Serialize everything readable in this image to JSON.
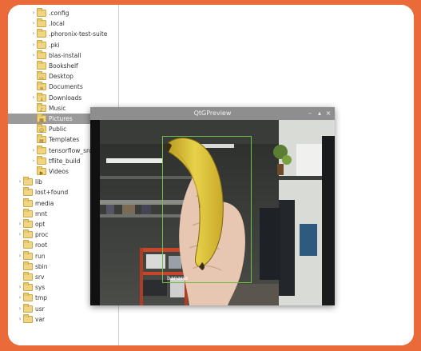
{
  "file_tree": {
    "items": [
      {
        "label": ".config",
        "expander": "›",
        "icon": "folder-icon"
      },
      {
        "label": ".local",
        "expander": "›",
        "icon": "folder-icon"
      },
      {
        "label": ".phoronix-test-suite",
        "expander": "›",
        "icon": "folder-icon"
      },
      {
        "label": ".pki",
        "expander": "›",
        "icon": "folder-icon"
      },
      {
        "label": "blas-install",
        "expander": "›",
        "icon": "folder-icon"
      },
      {
        "label": "Bookshelf",
        "expander": "",
        "icon": "folder-icon"
      },
      {
        "label": "Desktop",
        "expander": "",
        "icon": "desktop-folder-icon"
      },
      {
        "label": "Documents",
        "expander": "",
        "icon": "documents-folder-icon"
      },
      {
        "label": "Downloads",
        "expander": "›",
        "icon": "downloads-folder-icon"
      },
      {
        "label": "Music",
        "expander": "",
        "icon": "music-folder-icon"
      },
      {
        "label": "Pictures",
        "expander": "",
        "icon": "pictures-folder-icon"
      },
      {
        "label": "Public",
        "expander": "",
        "icon": "public-folder-icon"
      },
      {
        "label": "Templates",
        "expander": "",
        "icon": "templates-folder-icon"
      },
      {
        "label": "tensorflow_src",
        "expander": "›",
        "icon": "folder-icon"
      },
      {
        "label": "tflite_build",
        "expander": "›",
        "icon": "folder-icon"
      },
      {
        "label": "Videos",
        "expander": "",
        "icon": "videos-folder-icon"
      },
      {
        "label": "lib",
        "expander": "›",
        "icon": "folder-icon"
      },
      {
        "label": "lost+found",
        "expander": "",
        "icon": "folder-icon"
      },
      {
        "label": "media",
        "expander": "",
        "icon": "folder-icon"
      },
      {
        "label": "mnt",
        "expander": "",
        "icon": "folder-icon"
      },
      {
        "label": "opt",
        "expander": "›",
        "icon": "folder-icon"
      },
      {
        "label": "proc",
        "expander": "›",
        "icon": "folder-icon"
      },
      {
        "label": "root",
        "expander": "",
        "icon": "folder-icon"
      },
      {
        "label": "run",
        "expander": "›",
        "icon": "folder-icon"
      },
      {
        "label": "sbin",
        "expander": "",
        "icon": "folder-icon"
      },
      {
        "label": "srv",
        "expander": "",
        "icon": "folder-icon"
      },
      {
        "label": "sys",
        "expander": "›",
        "icon": "folder-icon"
      },
      {
        "label": "tmp",
        "expander": "›",
        "icon": "folder-icon"
      },
      {
        "label": "usr",
        "expander": "›",
        "icon": "folder-icon"
      },
      {
        "label": "var",
        "expander": "›",
        "icon": "folder-icon"
      }
    ],
    "selected_label": "Pictures"
  },
  "preview_window": {
    "title": "QtGPreview",
    "minimize_glyph": "–",
    "maximize_glyph": "▴",
    "close_glyph": "×",
    "detection_label": "banana",
    "colors": {
      "bbox": "#6fbf43",
      "titlebar": "#8e8e8e"
    }
  },
  "colors": {
    "background": "#ea6a3a",
    "selection": "#9a9a9a"
  }
}
